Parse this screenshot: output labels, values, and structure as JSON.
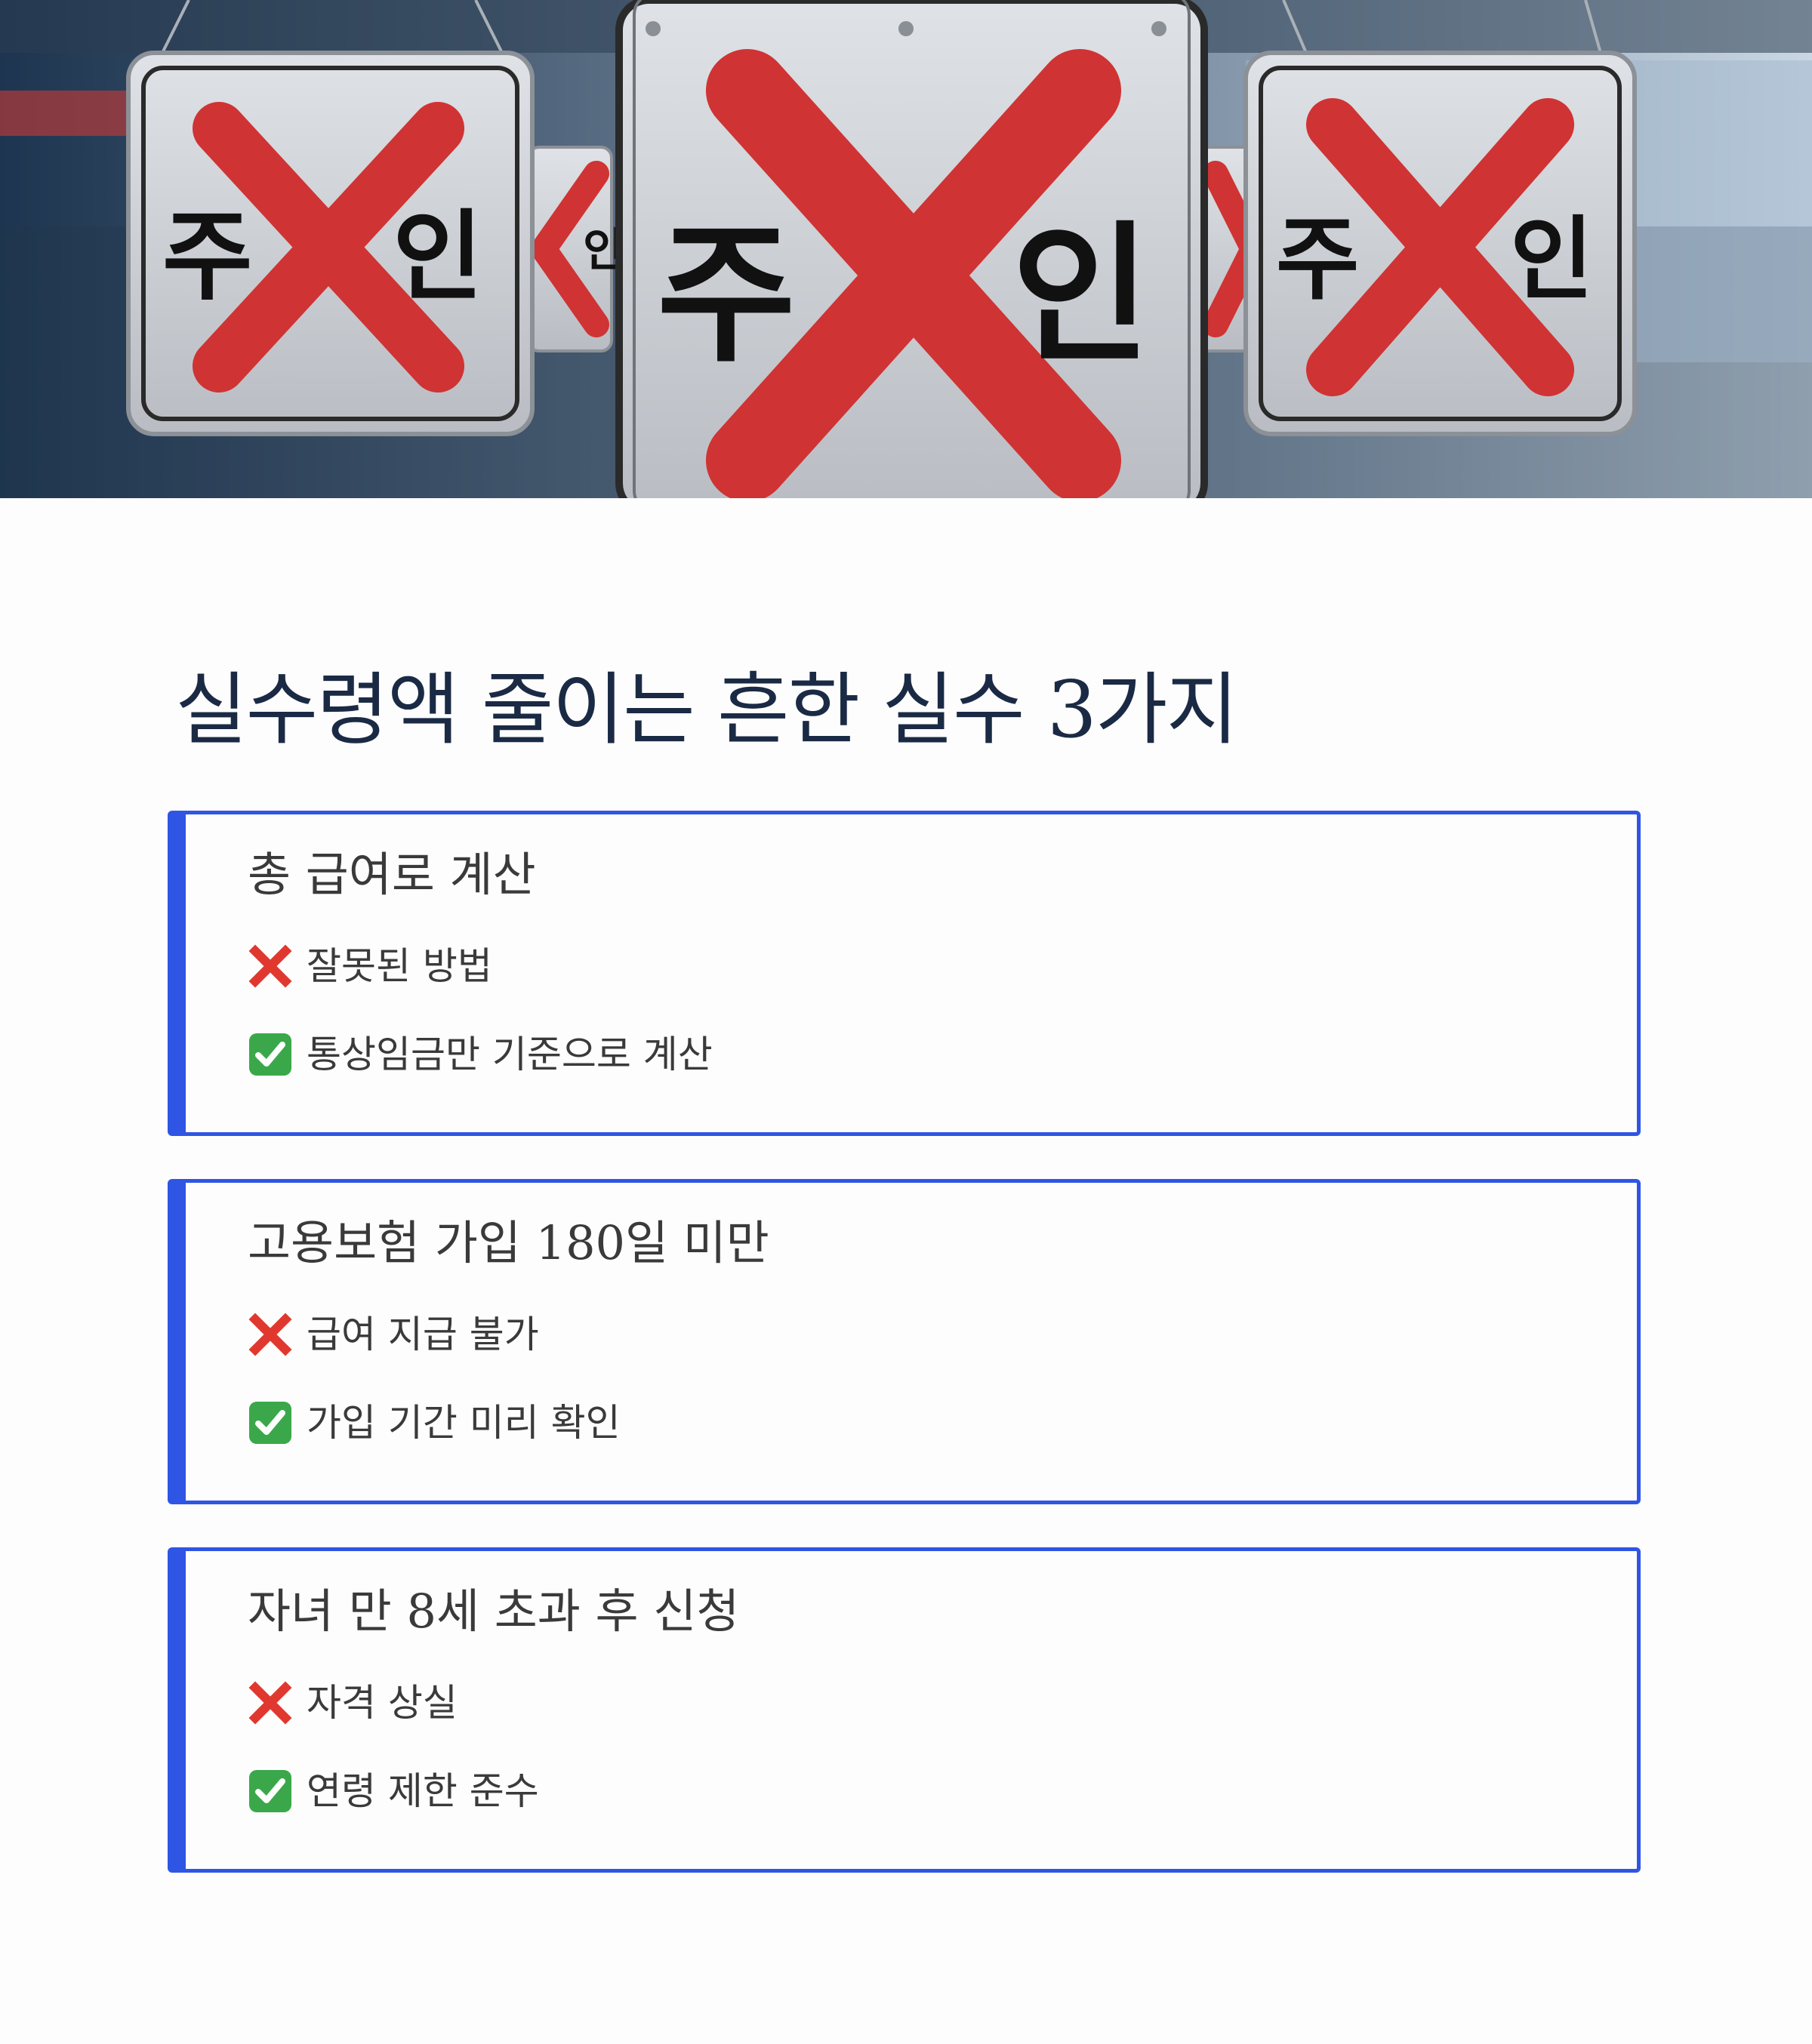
{
  "hero": {
    "sign_left": {
      "char_left": "주",
      "char_right": "인"
    },
    "sign_center": {
      "char_left": "주",
      "char_right": "인"
    },
    "sign_right": {
      "char_left": "주",
      "char_right": "인"
    },
    "sign_partial": "인",
    "colors": {
      "x_mark": "#d03333",
      "plate": "#cfd2d6",
      "background": "#3a4f66"
    }
  },
  "title": "실수령액 줄이는 흔한 실수 3가지",
  "colors": {
    "accent": "#2f55e4",
    "title": "#1b2a44",
    "text": "#3a3a3a",
    "bad_icon": "#e0382f",
    "good_icon": "#3aa84a"
  },
  "cards": [
    {
      "title": "총 급여로 계산",
      "bad": {
        "icon": "cross-mark-icon",
        "text": "잘못된 방법"
      },
      "good": {
        "icon": "check-mark-icon",
        "text": "통상임금만 기준으로 계산"
      }
    },
    {
      "title": "고용보험 가입 180일 미만",
      "bad": {
        "icon": "cross-mark-icon",
        "text": "급여 지급 불가"
      },
      "good": {
        "icon": "check-mark-icon",
        "text": "가입 기간 미리 확인"
      }
    },
    {
      "title": "자녀 만 8세 초과 후 신청",
      "bad": {
        "icon": "cross-mark-icon",
        "text": "자격 상실"
      },
      "good": {
        "icon": "check-mark-icon",
        "text": "연령 제한 준수"
      }
    }
  ]
}
